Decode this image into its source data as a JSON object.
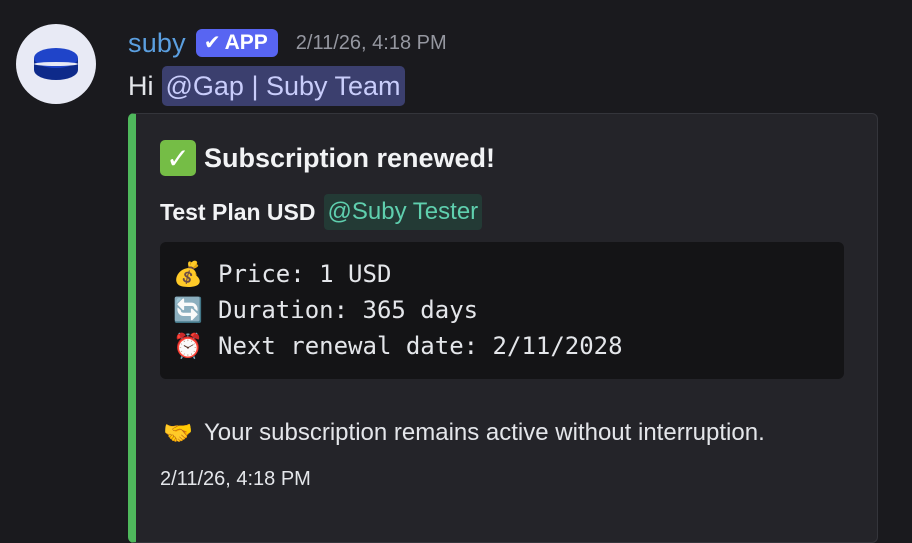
{
  "message": {
    "author": "suby",
    "badge": {
      "check": "✔",
      "label": "APP"
    },
    "timestamp": "2/11/26, 4:18 PM",
    "greeting": "Hi",
    "mention": "@Gap | Suby Team"
  },
  "embed": {
    "accent_color": "#4fb85c",
    "title_icon": "white-check-mark-icon",
    "title_icon_glyph": "✓",
    "title": "Subscription renewed!",
    "plan_name": "Test Plan USD",
    "plan_mention": "@Suby Tester",
    "code_lines": [
      {
        "icon": "money-bag-icon",
        "glyph": "💰",
        "text": "Price: 1 USD"
      },
      {
        "icon": "repeat-arrows-icon",
        "glyph": "🔄",
        "text": "Duration: 365 days"
      },
      {
        "icon": "alarm-clock-icon",
        "glyph": "⏰",
        "text": "Next renewal date: 2/11/2028"
      }
    ],
    "note_icon": "handshake-icon",
    "note_glyph": "🤝",
    "note": "Your subscription remains active without interruption.",
    "footer_timestamp": "2/11/26, 4:18 PM"
  },
  "colors": {
    "background": "#1a1a1e",
    "username": "#5b9fe0",
    "app_badge": "#5865f2",
    "user_mention_bg": "#3b3f6e",
    "role_mention_text": "#5fcfae"
  },
  "avatar_icon": "coin-stack-icon"
}
